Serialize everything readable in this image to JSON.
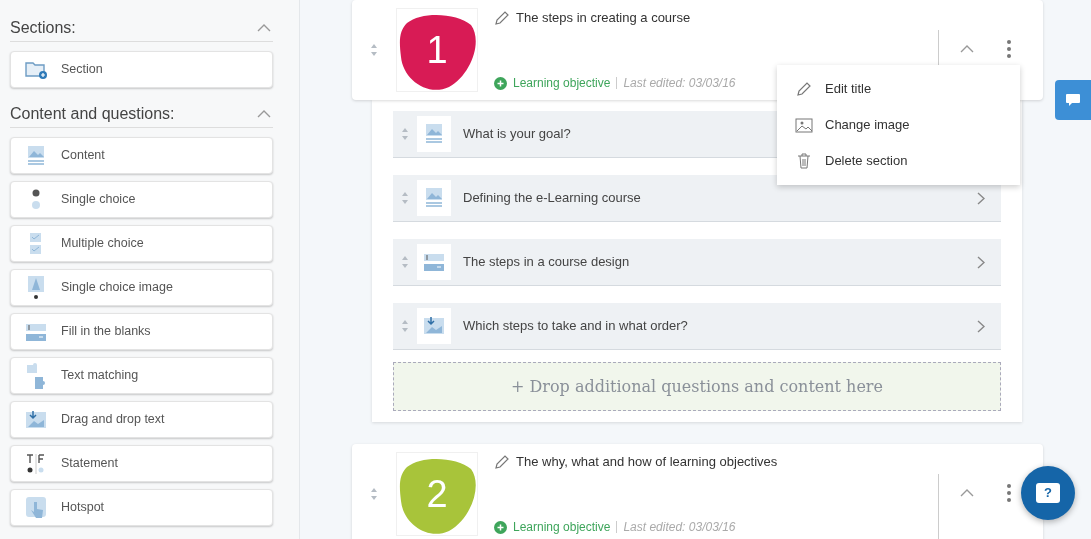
{
  "sidebar": {
    "groups": [
      {
        "title": "Sections:",
        "expanded": true,
        "items": [
          {
            "label": "Section",
            "kind": "section"
          }
        ]
      },
      {
        "title": "Content and questions:",
        "expanded": true,
        "items": [
          {
            "label": "Content",
            "kind": "content"
          },
          {
            "label": "Single choice",
            "kind": "single"
          },
          {
            "label": "Multiple choice",
            "kind": "multiple"
          },
          {
            "label": "Single choice image",
            "kind": "single_image"
          },
          {
            "label": "Fill in the blanks",
            "kind": "blanks"
          },
          {
            "label": "Text matching",
            "kind": "matching"
          },
          {
            "label": "Drag and drop text",
            "kind": "dragdrop"
          },
          {
            "label": "Statement",
            "kind": "statement"
          },
          {
            "label": "Hotspot",
            "kind": "hotspot"
          }
        ]
      }
    ]
  },
  "sections": [
    {
      "number": "1",
      "color": "#d81b55",
      "title": "The steps in creating a course",
      "objective": "Learning objective",
      "last_edited": "Last edited: 03/03/16",
      "expanded": true,
      "menu": [
        {
          "label": "Edit title",
          "kind": "edit"
        },
        {
          "label": "Change image",
          "kind": "image"
        },
        {
          "label": "Delete section",
          "kind": "delete"
        }
      ],
      "questions": [
        {
          "title": "What is your goal?",
          "kind": "content"
        },
        {
          "title": "Defining the e-Learning course",
          "kind": "content"
        },
        {
          "title": "The steps in a course design",
          "kind": "blanks"
        },
        {
          "title": "Which steps to take and in what order?",
          "kind": "dragdrop"
        }
      ],
      "drop_hint": "+ Drop additional questions and content here"
    },
    {
      "number": "2",
      "color": "#a8c43a",
      "title": "The why, what and how of learning objectives",
      "objective": "Learning objective",
      "last_edited": "Last edited: 03/03/16",
      "expanded": true
    }
  ],
  "help_button": "?"
}
